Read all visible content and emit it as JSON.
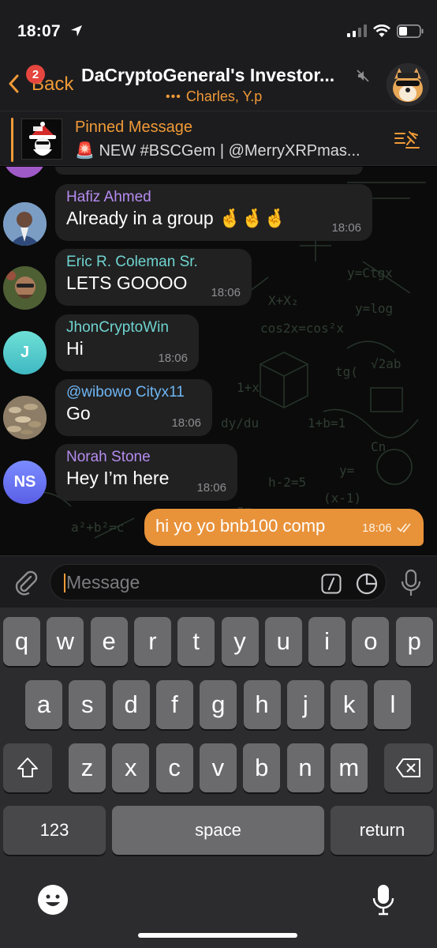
{
  "status_bar": {
    "time": "18:07"
  },
  "header": {
    "back_label": "Back",
    "back_badge": "2",
    "title": "DaCryptoGeneral's Investor...",
    "typing_text": "Charles, Y.p",
    "typing_dots": "•••"
  },
  "pinned": {
    "title": "Pinned Message",
    "text": "🚨 NEW #BSCGem | @MerryXRPmas...",
    "thumb_label": "XRP"
  },
  "messages": [
    {
      "sender": "Hafiz Ahmed",
      "sender_color": "#b58cf0",
      "text": "Already in a group 🤞🤞🤞",
      "time": "18:06",
      "avatar_initials": ""
    },
    {
      "sender": "Eric R. Coleman Sr.",
      "sender_color": "#6fd4d0",
      "text": "LETS GOOOO",
      "time": "18:06",
      "avatar_initials": ""
    },
    {
      "sender": "JhonCryptoWin",
      "sender_color": "#6fd4d0",
      "text": "Hi",
      "time": "18:06",
      "avatar_initials": "J"
    },
    {
      "sender": "@wibowo Cityx11",
      "sender_color": "#6fb6f5",
      "text": "Go",
      "time": "18:06",
      "avatar_initials": ""
    },
    {
      "sender": "Norah Stone",
      "sender_color": "#b58cf0",
      "text": "Hey I’m here",
      "time": "18:06",
      "avatar_initials": "NS"
    }
  ],
  "outgoing": {
    "text": "hi yo yo bnb100 comp",
    "time": "18:06"
  },
  "input": {
    "placeholder": "Message",
    "value": ""
  },
  "keyboard": {
    "row1": [
      "q",
      "w",
      "e",
      "r",
      "t",
      "y",
      "u",
      "i",
      "o",
      "p"
    ],
    "row2": [
      "a",
      "s",
      "d",
      "f",
      "g",
      "h",
      "j",
      "k",
      "l"
    ],
    "row3": [
      "z",
      "x",
      "c",
      "v",
      "b",
      "n",
      "m"
    ],
    "numbers_label": "123",
    "space_label": "space",
    "return_label": "return"
  },
  "colors": {
    "accent": "#f09a37",
    "outgoing_bubble": "#e8923a",
    "incoming_bubble": "#212121",
    "badge": "#e5463f"
  }
}
